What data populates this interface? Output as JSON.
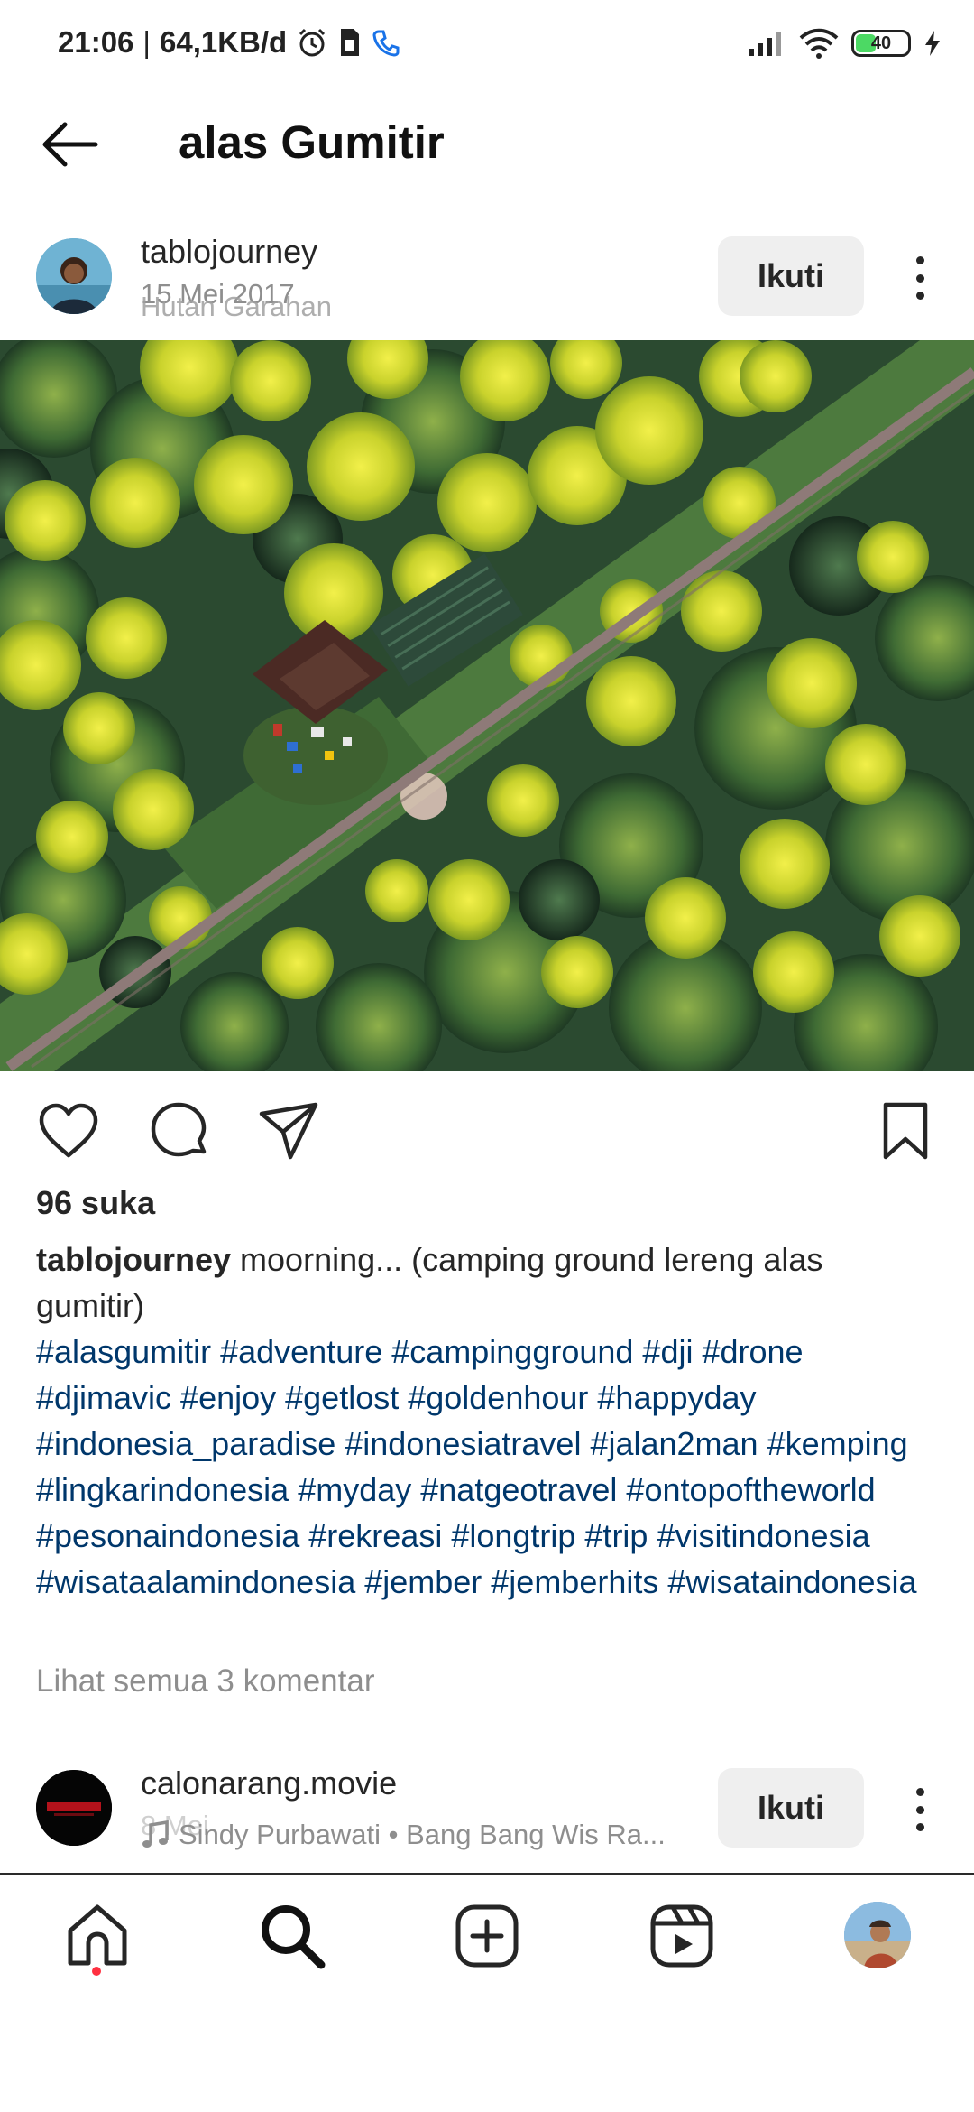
{
  "status_bar": {
    "time": "21:06",
    "separator": "|",
    "speed": "64,1KB/d",
    "battery": "40"
  },
  "header": {
    "title": "alas Gumitir"
  },
  "post": {
    "username": "tablojourney",
    "date": "15 Mei 2017",
    "location": "Hutan Garahan",
    "follow_label": "Ikuti",
    "likes": "96 suka",
    "caption_user": "tablojourney",
    "caption_text": "moorning... (camping ground lereng alas gumitir)",
    "hashtags": "#alasgumitir #adventure #campingground #dji #drone #djimavic #enjoy #getlost #goldenhour #happyday #indonesia_paradise #indonesiatravel #jalan2man #kemping #lingkarindonesia #myday #natgeotravel #ontopoftheworld #pesonaindonesia #rekreasi #longtrip #trip #visitindonesia #wisataalamindonesia #jember #jemberhits #wisataindonesia",
    "comments_link": "Lihat semua 3 komentar"
  },
  "next_post": {
    "username": "calonarang.movie",
    "date": "8 Mei",
    "music": "Sindy Purbawati • Bang Bang Wis Ra...",
    "follow_label": "Ikuti"
  },
  "icons": {
    "back": "arrow-left-icon",
    "like": "heart-icon",
    "comment": "comment-bubble-icon",
    "share": "paper-plane-icon",
    "save": "bookmark-icon",
    "nav": [
      "home-icon",
      "search-icon",
      "add-post-icon",
      "reels-icon",
      "profile-avatar"
    ]
  },
  "colors": {
    "hashtag": "#00376b",
    "follow_bg": "#efefef",
    "notification_dot": "#ff3040",
    "battery_green": "#4cd964"
  }
}
